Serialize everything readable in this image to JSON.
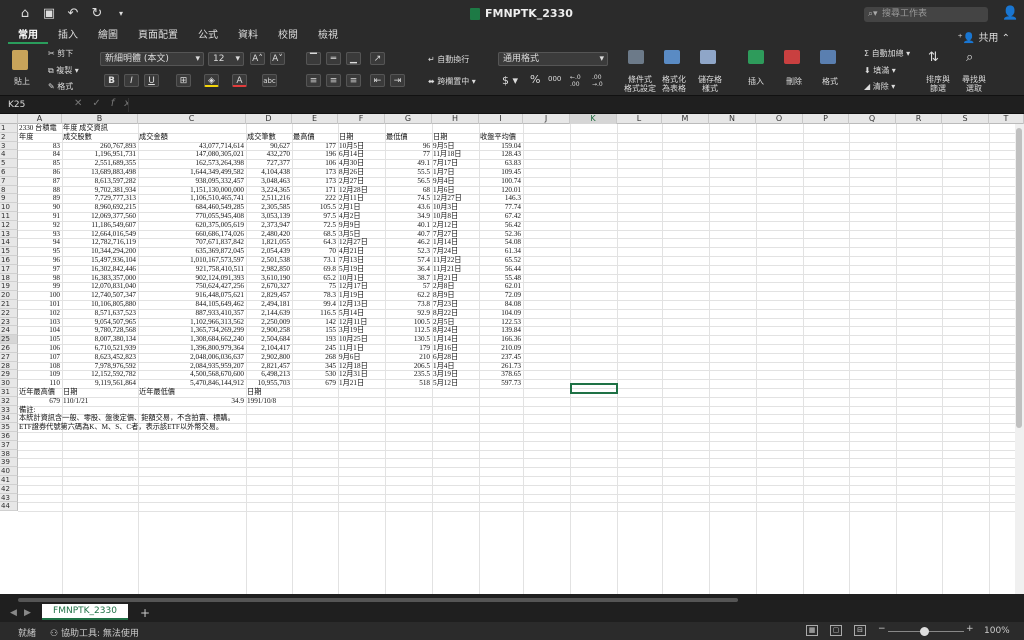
{
  "titlebar": {
    "title": "FMNPTK_2330",
    "search_placeholder": "搜尋工作表"
  },
  "tabs": [
    "常用",
    "插入",
    "繪圖",
    "頁面配置",
    "公式",
    "資料",
    "校閱",
    "檢視"
  ],
  "share": "共用",
  "ribbon": {
    "paste": "貼上",
    "cut": "剪下",
    "copy": "複製",
    "format": "格式",
    "font_name": "新細明體 (本文)",
    "font_size": "12",
    "wrap": "自動換行",
    "merge": "跨欄置中",
    "number_format": "通用格式",
    "cond": [
      "條件式",
      "格式設定"
    ],
    "as_table": [
      "格式化",
      "為表格"
    ],
    "cell_style": [
      "儲存格",
      "樣式"
    ],
    "insert": "插入",
    "delete": "刪除",
    "format2": "格式",
    "autosum": "自動加總",
    "fill": "填滿",
    "clear": "清除",
    "sort": [
      "排序與",
      "篩選"
    ],
    "find": [
      "尋找與",
      "選取"
    ]
  },
  "namebox": "K25",
  "columns": [
    "A",
    "B",
    "C",
    "D",
    "E",
    "F",
    "G",
    "H",
    "I",
    "J",
    "K",
    "L",
    "M",
    "N",
    "O",
    "P",
    "Q",
    "R",
    "S",
    "T"
  ],
  "selected_column": "K",
  "selected_row": "25",
  "rows": [
    [
      "2330 台積電",
      "年度 成交資訊",
      "",
      "",
      "",
      "",
      "",
      "",
      "",
      ""
    ],
    [
      "年度",
      "成交股數",
      "成交金額",
      "成交筆數",
      "最高價",
      "日期",
      "最低價",
      "日期",
      "收盤平均價",
      ""
    ],
    [
      "83",
      "260,767,893",
      "43,077,714,614",
      "90,627",
      "177",
      "10月5日",
      "96",
      "9月5日",
      "159.04",
      ""
    ],
    [
      "84",
      "1,196,951,731",
      "147,080,305,021",
      "432,270",
      "196",
      "6月14日",
      "77",
      "11月18日",
      "128.43",
      ""
    ],
    [
      "85",
      "2,551,689,355",
      "162,573,264,398",
      "727,377",
      "106",
      "4月30日",
      "49.1",
      "7月17日",
      "63.83",
      ""
    ],
    [
      "86",
      "13,689,883,498",
      "1,644,349,499,582",
      "4,104,438",
      "173",
      "8月26日",
      "55.5",
      "1月7日",
      "109.45",
      ""
    ],
    [
      "87",
      "8,613,597,282",
      "938,095,332,457",
      "3,048,463",
      "173",
      "2月27日",
      "56.5",
      "9月4日",
      "100.74",
      ""
    ],
    [
      "88",
      "9,702,381,934",
      "1,151,130,000,000",
      "3,224,365",
      "171",
      "12月28日",
      "68",
      "1月6日",
      "120.01",
      ""
    ],
    [
      "89",
      "7,729,777,313",
      "1,106,510,465,741",
      "2,511,216",
      "222",
      "2月11日",
      "74.5",
      "12月27日",
      "146.3",
      ""
    ],
    [
      "90",
      "8,960,692,215",
      "684,460,549,285",
      "2,305,585",
      "105.5",
      "2月1日",
      "43.6",
      "10月3日",
      "77.74",
      ""
    ],
    [
      "91",
      "12,069,377,560",
      "770,055,945,408",
      "3,053,139",
      "97.5",
      "4月2日",
      "34.9",
      "10月8日",
      "67.42",
      ""
    ],
    [
      "92",
      "11,186,549,607",
      "620,375,005,619",
      "2,373,947",
      "72.5",
      "9月9日",
      "40.1",
      "2月12日",
      "56.42",
      ""
    ],
    [
      "93",
      "12,664,016,549",
      "660,686,174,026",
      "2,480,420",
      "68.5",
      "3月5日",
      "40.7",
      "7月27日",
      "52.36",
      ""
    ],
    [
      "94",
      "12,782,716,119",
      "707,671,837,842",
      "1,821,055",
      "64.3",
      "12月27日",
      "46.2",
      "1月14日",
      "54.08",
      ""
    ],
    [
      "95",
      "10,344,294,200",
      "635,369,872,045",
      "2,054,439",
      "70",
      "4月21日",
      "52.3",
      "7月24日",
      "61.34",
      ""
    ],
    [
      "96",
      "15,497,936,104",
      "1,010,167,573,597",
      "2,501,538",
      "73.1",
      "7月13日",
      "57.4",
      "11月22日",
      "65.52",
      ""
    ],
    [
      "97",
      "16,302,842,446",
      "921,758,410,511",
      "2,982,850",
      "69.8",
      "5月19日",
      "36.4",
      "11月21日",
      "56.44",
      ""
    ],
    [
      "98",
      "16,383,357,000",
      "902,124,091,393",
      "3,610,190",
      "65.2",
      "10月1日",
      "38.7",
      "1月21日",
      "55.48",
      ""
    ],
    [
      "99",
      "12,070,831,040",
      "750,624,427,256",
      "2,670,327",
      "75",
      "12月17日",
      "57",
      "2月8日",
      "62.01",
      ""
    ],
    [
      "100",
      "12,740,507,347",
      "916,448,075,621",
      "2,829,457",
      "78.3",
      "1月19日",
      "62.2",
      "8月9日",
      "72.09",
      ""
    ],
    [
      "101",
      "10,106,805,880",
      "844,105,649,462",
      "2,494,181",
      "99.4",
      "12月13日",
      "73.8",
      "7月23日",
      "84.08",
      ""
    ],
    [
      "102",
      "8,571,637,523",
      "887,933,410,357",
      "2,144,639",
      "116.5",
      "5月14日",
      "92.9",
      "8月22日",
      "104.09",
      ""
    ],
    [
      "103",
      "9,054,507,965",
      "1,102,966,313,562",
      "2,250,009",
      "142",
      "12月11日",
      "100.5",
      "2月5日",
      "122.53",
      ""
    ],
    [
      "104",
      "9,780,728,568",
      "1,365,734,269,299",
      "2,900,258",
      "155",
      "3月19日",
      "112.5",
      "8月24日",
      "139.84",
      ""
    ],
    [
      "105",
      "8,007,380,134",
      "1,308,684,662,240",
      "2,504,684",
      "193",
      "10月25日",
      "130.5",
      "1月14日",
      "166.36",
      ""
    ],
    [
      "106",
      "6,710,521,939",
      "1,396,800,979,364",
      "2,104,417",
      "245",
      "11月1日",
      "179",
      "1月16日",
      "210.09",
      ""
    ],
    [
      "107",
      "8,623,452,823",
      "2,048,006,036,637",
      "2,902,800",
      "268",
      "9月6日",
      "210",
      "6月28日",
      "237.45",
      ""
    ],
    [
      "108",
      "7,978,976,592",
      "2,084,935,959,207",
      "2,821,457",
      "345",
      "12月18日",
      "206.5",
      "1月4日",
      "261.73",
      ""
    ],
    [
      "109",
      "12,152,592,782",
      "4,500,568,670,600",
      "6,498,213",
      "530",
      "12月31日",
      "235.5",
      "3月19日",
      "378.65",
      ""
    ],
    [
      "110",
      "9,119,561,864",
      "5,470,846,144,912",
      "10,955,703",
      "679",
      "1月21日",
      "518",
      "5月12日",
      "597.73",
      ""
    ],
    [
      "近年最高價",
      "日期",
      "近年最低價",
      "日期",
      "",
      "",
      "",
      "",
      "",
      ""
    ],
    [
      "679",
      "110/1/21",
      "34.9",
      "1991/10/8",
      "",
      "",
      "",
      "",
      "",
      ""
    ],
    [
      "備註:",
      "",
      "",
      "",
      "",
      "",
      "",
      "",
      "",
      ""
    ],
    [
      "本統計資訊含一般、零股、盤後定價、鉅額交易，不含拍賣、標購。",
      "",
      "",
      "",
      "",
      "",
      "",
      "",
      "",
      ""
    ],
    [
      "ETF證券代號第六碼為K、M、S、C者，表示該ETF以外幣交易。",
      "",
      "",
      "",
      "",
      "",
      "",
      "",
      "",
      ""
    ]
  ],
  "row_numbers": [
    "1",
    "2",
    "3",
    "4",
    "5",
    "6",
    "7",
    "8",
    "9",
    "10",
    "11",
    "12",
    "13",
    "14",
    "15",
    "16",
    "17",
    "18",
    "19",
    "20",
    "21",
    "22",
    "23",
    "24",
    "25",
    "26",
    "27",
    "28",
    "29",
    "30",
    "31",
    "32",
    "33",
    "34",
    "35",
    "36",
    "37",
    "38",
    "39",
    "40",
    "41",
    "42",
    "43",
    "44"
  ],
  "sheet_tab": "FMNPTK_2330",
  "status": {
    "ready": "就緒",
    "accessibility": "協助工具: 無法使用",
    "zoom": "100%"
  }
}
